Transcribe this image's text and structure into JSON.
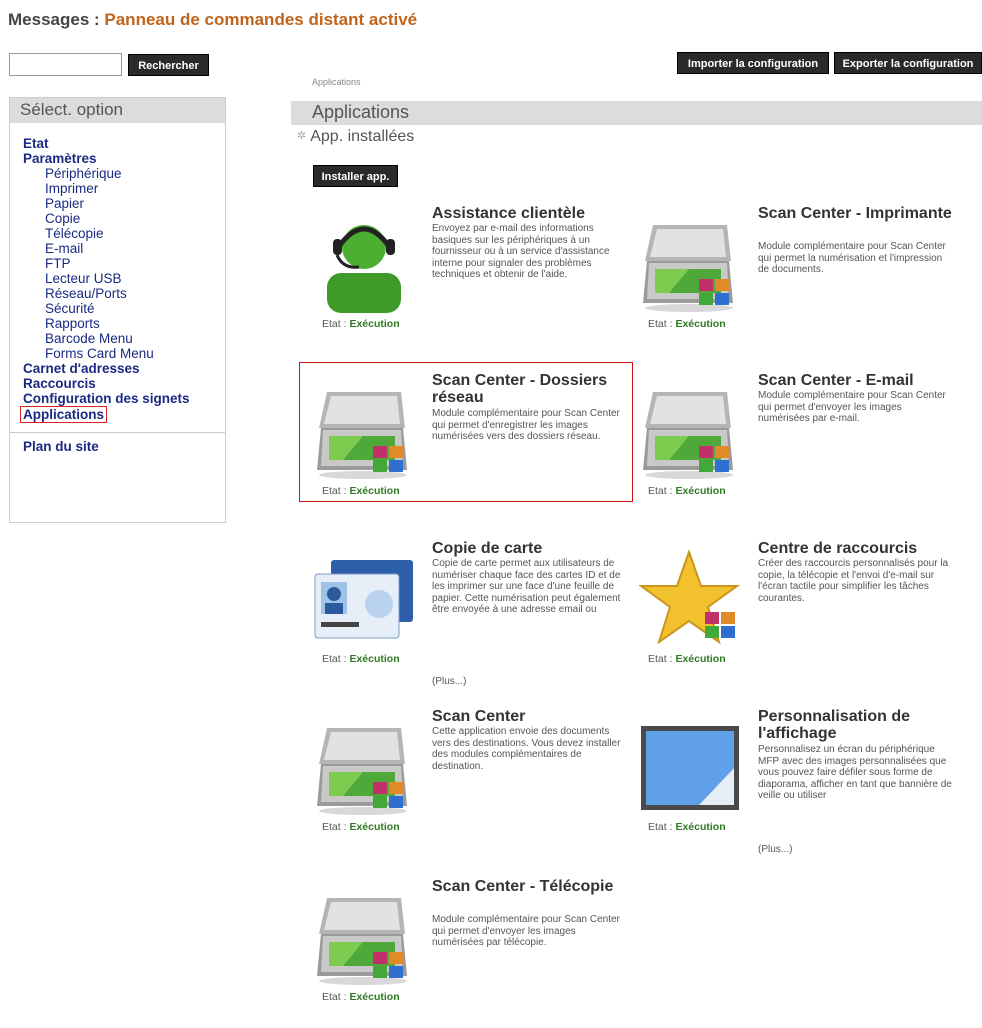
{
  "header": {
    "label": "Messages : ",
    "message": "Panneau de commandes distant activé"
  },
  "search": {
    "value": "",
    "button_label": "Rechercher"
  },
  "toolbar": {
    "import_label": "Importer la configuration",
    "export_label": "Exporter la configuration"
  },
  "breadcrumb": "Applications",
  "sidebar": {
    "heading": "Sélect. option",
    "items": [
      {
        "label": "Etat",
        "level": "top"
      },
      {
        "label": "Paramètres",
        "level": "top"
      },
      {
        "label": "Périphérique",
        "level": "sub"
      },
      {
        "label": "Imprimer",
        "level": "sub"
      },
      {
        "label": "Papier",
        "level": "sub"
      },
      {
        "label": "Copie",
        "level": "sub"
      },
      {
        "label": "Télécopie",
        "level": "sub"
      },
      {
        "label": "E-mail",
        "level": "sub"
      },
      {
        "label": "FTP",
        "level": "sub"
      },
      {
        "label": "Lecteur USB",
        "level": "sub"
      },
      {
        "label": "Réseau/Ports",
        "level": "sub"
      },
      {
        "label": "Sécurité",
        "level": "sub"
      },
      {
        "label": "Rapports",
        "level": "sub"
      },
      {
        "label": "Barcode Menu",
        "level": "sub"
      },
      {
        "label": "Forms Card Menu",
        "level": "sub"
      },
      {
        "label": "Carnet d'adresses",
        "level": "top"
      },
      {
        "label": "Raccourcis",
        "level": "top"
      },
      {
        "label": "Configuration des signets",
        "level": "top"
      },
      {
        "label": "Applications",
        "level": "top",
        "active": true
      }
    ],
    "footer": "Plan du site"
  },
  "main": {
    "heading": "Applications",
    "subheading": "App. installées",
    "install_label": "Installer app."
  },
  "state_label": "Etat : ",
  "apps": [
    {
      "title": "Assistance clientèle",
      "icon": "headset-agent-icon",
      "desc": "Envoyez par e-mail des informations basiques sur les périphériques à un fournisseur ou à un service d'assistance interne pour signaler des problèmes techniques et obtenir de l'aide.",
      "state": "Exécution"
    },
    {
      "title": "Scan Center - Imprimante",
      "icon": "scanner-icon",
      "desc": "Module complémentaire pour Scan Center qui permet la numérisation et l'impression de documents.",
      "state": "Exécution"
    },
    {
      "title": "Scan Center - Dossiers réseau",
      "icon": "scanner-icon",
      "desc": "Module complémentaire pour Scan Center qui permet d'enregistrer les images numérisées vers des dossiers réseau.",
      "state": "Exécution",
      "selected": true
    },
    {
      "title": "Scan Center - E-mail",
      "icon": "scanner-icon",
      "desc": "Module complémentaire pour Scan Center qui permet d'envoyer les images numérisées par e-mail.",
      "state": "Exécution"
    },
    {
      "title": "Copie de carte",
      "icon": "id-card-icon",
      "desc": "Copie de carte permet aux utilisateurs de numériser chaque face des cartes ID et de les imprimer sur une face d'une feuille de papier. Cette numérisation peut également être envoyée à une adresse email ou",
      "state": "Exécution",
      "more": "(Plus...)"
    },
    {
      "title": "Centre de raccourcis",
      "icon": "star-icon",
      "desc": "Créer des raccourcis personnalisés pour la copie, la télécopie et l'envoi d'e-mail sur l'écran tactile pour simplifier les tâches courantes.",
      "state": "Exécution"
    },
    {
      "title": "Scan Center",
      "icon": "scanner-icon",
      "desc": "Cette application envoie des documents vers des destinations. Vous devez installer des modules complémentaires de destination.",
      "state": "Exécution"
    },
    {
      "title": "Personnalisation de l'affichage",
      "icon": "display-icon",
      "desc": "Personnalisez un écran du périphérique MFP avec des images personnalisées que vous pouvez faire défiler sous forme de diaporama, afficher en tant que bannière de veille ou utiliser",
      "state": "Exécution",
      "more": "(Plus...)"
    },
    {
      "title": "Scan Center - Télécopie",
      "icon": "scanner-icon",
      "desc": "Module complémentaire pour Scan Center qui permet d'envoyer les images numérisées par télécopie.",
      "state": "Exécution"
    }
  ]
}
